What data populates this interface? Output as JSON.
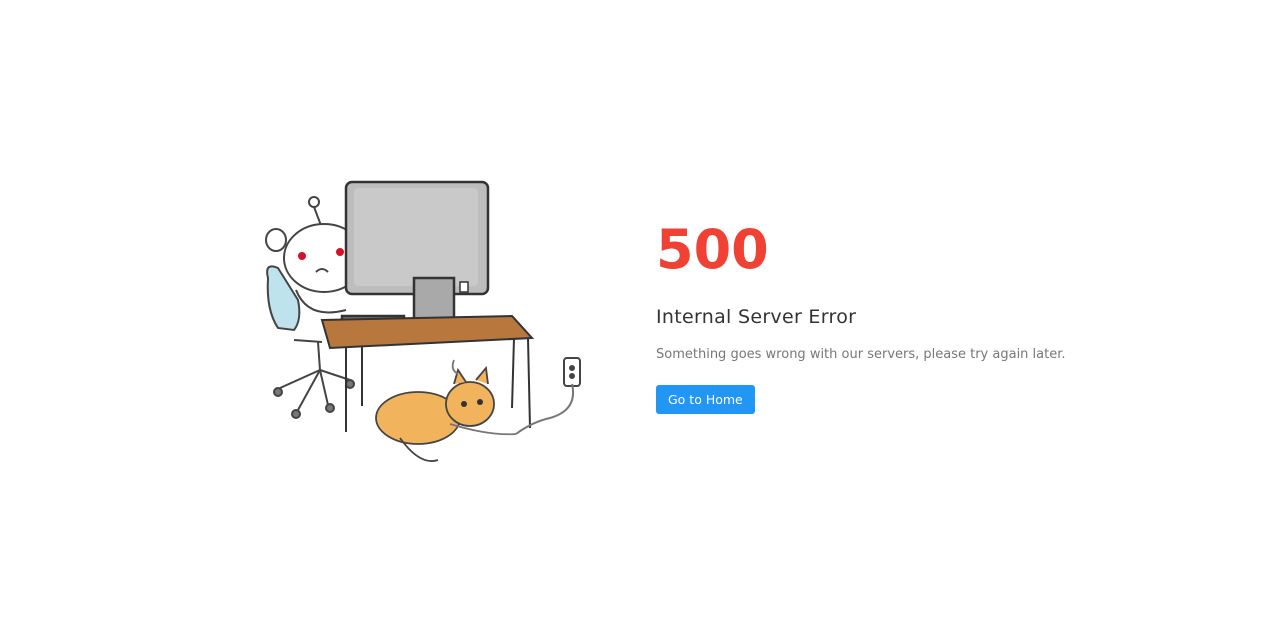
{
  "error": {
    "code": "500",
    "title": "Internal Server Error",
    "description": "Something goes wrong with our servers, please try again later.",
    "home_button_label": "Go to Home"
  },
  "colors": {
    "code": "#f04134",
    "button": "#2196f3",
    "title": "#333333",
    "description": "#777777"
  },
  "illustration": {
    "icon": "robot-at-computer-with-cat-illustration"
  }
}
